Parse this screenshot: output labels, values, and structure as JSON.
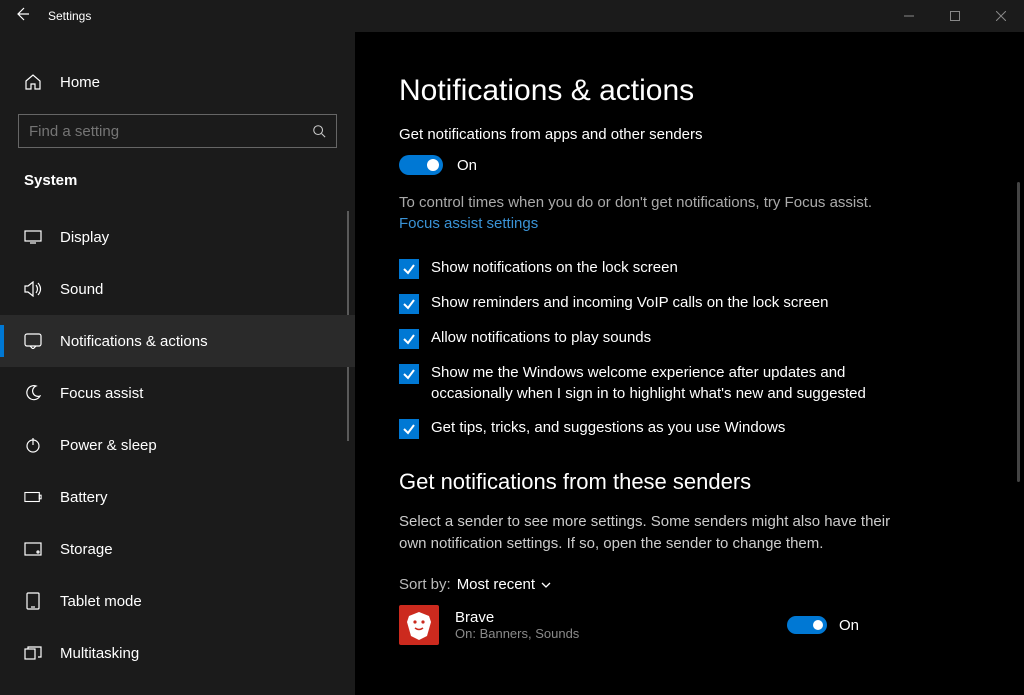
{
  "titlebar": {
    "title": "Settings"
  },
  "sidebar": {
    "home": "Home",
    "search_placeholder": "Find a setting",
    "category": "System",
    "items": [
      {
        "label": "Display"
      },
      {
        "label": "Sound"
      },
      {
        "label": "Notifications & actions"
      },
      {
        "label": "Focus assist"
      },
      {
        "label": "Power & sleep"
      },
      {
        "label": "Battery"
      },
      {
        "label": "Storage"
      },
      {
        "label": "Tablet mode"
      },
      {
        "label": "Multitasking"
      }
    ]
  },
  "main": {
    "heading": "Notifications & actions",
    "master_label": "Get notifications from apps and other senders",
    "master_state": "On",
    "hint": "To control times when you do or don't get notifications, try Focus assist.",
    "link": "Focus assist settings",
    "checkboxes": [
      "Show notifications on the lock screen",
      "Show reminders and incoming VoIP calls on the lock screen",
      "Allow notifications to play sounds",
      "Show me the Windows welcome experience after updates and occasionally when I sign in to highlight what's new and suggested",
      "Get tips, tricks, and suggestions as you use Windows"
    ],
    "senders_heading": "Get notifications from these senders",
    "senders_desc": "Select a sender to see more settings. Some senders might also have their own notification settings. If so, open the sender to change them.",
    "sort_label": "Sort by:",
    "sort_value": "Most recent",
    "sender": {
      "name": "Brave",
      "sub": "On: Banners, Sounds",
      "state": "On"
    }
  }
}
